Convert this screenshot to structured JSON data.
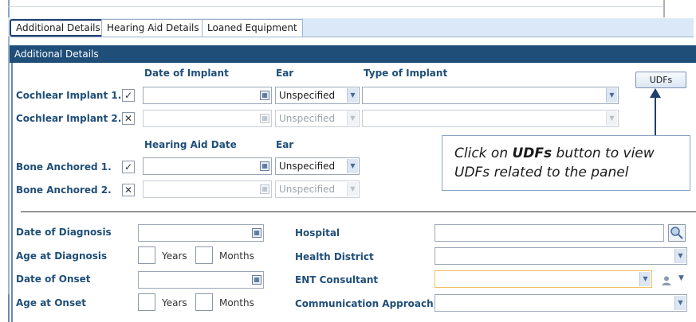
{
  "tabs": [
    {
      "label": "Additional Details"
    },
    {
      "label": "Hearing Aid Details"
    },
    {
      "label": "Loaned Equipment"
    }
  ],
  "panel": {
    "title": "Additional Details"
  },
  "implant_headers": {
    "date": "Date of Implant",
    "ear": "Ear",
    "type": "Type of Implant"
  },
  "cochlear": [
    {
      "label": "Cochlear Implant 1.",
      "checked": "✓",
      "ear": "Unspecified"
    },
    {
      "label": "Cochlear Implant 2.",
      "checked": "✕",
      "ear": "Unspecified"
    }
  ],
  "bone_headers": {
    "date": "Hearing Aid Date",
    "ear": "Ear"
  },
  "bone": [
    {
      "label": "Bone Anchored 1.",
      "checked": "✓",
      "ear": "Unspecified"
    },
    {
      "label": "Bone Anchored 2.",
      "checked": "✕",
      "ear": "Unspecified"
    }
  ],
  "udf_button": {
    "label": "UDFs"
  },
  "callout": {
    "prefix": "Click on ",
    "bold": "UDFs",
    "suffix": " button to view",
    "line2": "UDFs related to the panel"
  },
  "diagnosis": {
    "date_of_diagnosis": "Date of Diagnosis",
    "age_at_diagnosis": "Age at Diagnosis",
    "date_of_onset": "Date of Onset",
    "age_at_onset": "Age at Onset",
    "years": "Years",
    "months": "Months"
  },
  "right_fields": {
    "hospital": "Hospital",
    "health_district": "Health District",
    "ent_consultant": "ENT Consultant",
    "communication_approach": "Communication Approach"
  },
  "colors": {
    "header_bg": "#1f4e79",
    "label": "#1f4e79",
    "tab_bar": "#dbe8f7",
    "highlight_border": "#f0c060"
  }
}
